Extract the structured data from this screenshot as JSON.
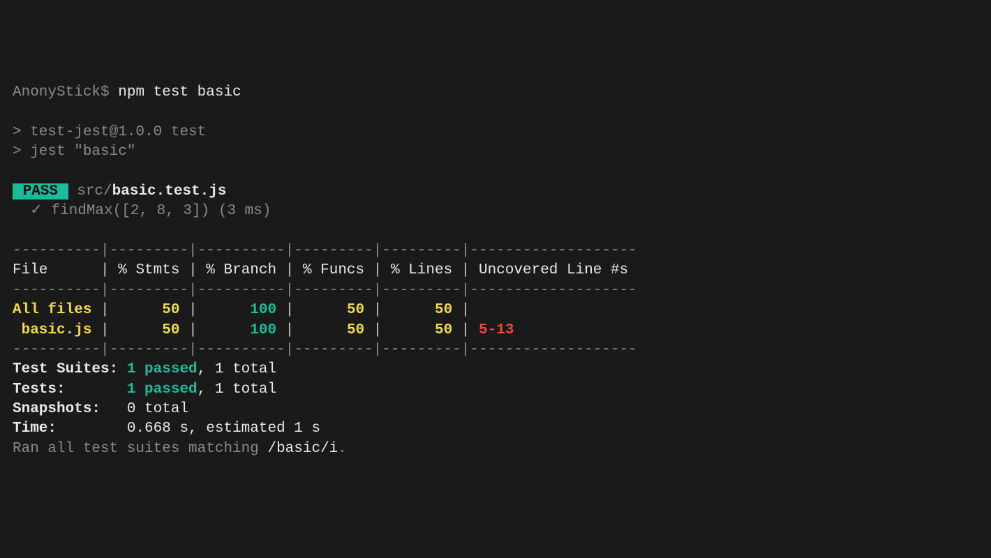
{
  "prompt": "AnonyStick$",
  "command": "npm test basic",
  "runner": {
    "line1": "> test-jest@1.0.0 test",
    "line2": "> jest \"basic\""
  },
  "pass_badge": " PASS ",
  "test_file_prefix": " src/",
  "test_file": "basic.test.js",
  "test_line_prefix": "  ✓ ",
  "test_line": "findMax([2, 8, 3]) (3 ms)",
  "table": {
    "sep_top": "----------|---------|----------|---------|---------|-------------------",
    "header": {
      "file": "File",
      "stmts": "% Stmts",
      "branch": "% Branch",
      "funcs": "% Funcs",
      "lines": "% Lines",
      "uncov": "Uncovered Line #s"
    },
    "sep_mid": "----------|---------|----------|---------|---------|-------------------",
    "rows": [
      {
        "file": "All files",
        "stmts": "50",
        "branch": "100",
        "funcs": "50",
        "lines": "50",
        "uncov": ""
      },
      {
        "file": " basic.js",
        "stmts": "50",
        "branch": "100",
        "funcs": "50",
        "lines": "50",
        "uncov": "5-13"
      }
    ],
    "sep_bot": "----------|---------|----------|---------|---------|-------------------"
  },
  "summary": {
    "suites_label": "Test Suites:",
    "suites_pass": "1 passed",
    "suites_rest": ", 1 total",
    "tests_label": "Tests:",
    "tests_pass": "1 passed",
    "tests_rest": ", 1 total",
    "snapshots_label": "Snapshots:",
    "snapshots_val": "0 total",
    "time_label": "Time:",
    "time_val": "0.668 s, estimated 1 s",
    "ran_prefix": "Ran all test suites matching ",
    "ran_pattern": "/basic/i",
    "ran_suffix": "."
  }
}
